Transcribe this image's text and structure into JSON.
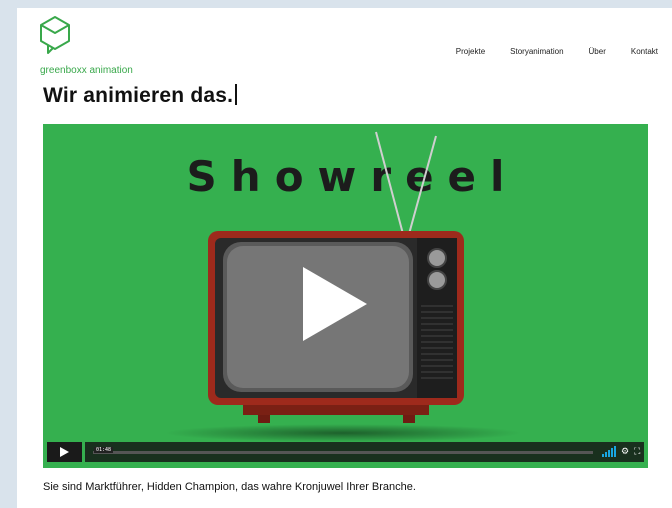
{
  "brand": {
    "logo_name_bold": "greenboxx",
    "logo_name_rest": " animation"
  },
  "nav": {
    "items": [
      "Projekte",
      "Storyanimation",
      "Über",
      "Kontakt"
    ]
  },
  "headline": "Wir animieren das.",
  "video": {
    "title_text": "Showreel",
    "current_time": "01:48",
    "progress_fraction": 0.0,
    "volume_level": 1.0,
    "accent_color": "#19a7e1",
    "background_color": "#35b04f",
    "icons": [
      "play-icon",
      "volume-icon",
      "settings-icon",
      "fullscreen-icon"
    ]
  },
  "intro_text": "Sie sind Marktführer, Hidden Champion, das wahre Kronjuwel Ihrer Branche.",
  "colors": {
    "brand_green": "#39a84b"
  }
}
